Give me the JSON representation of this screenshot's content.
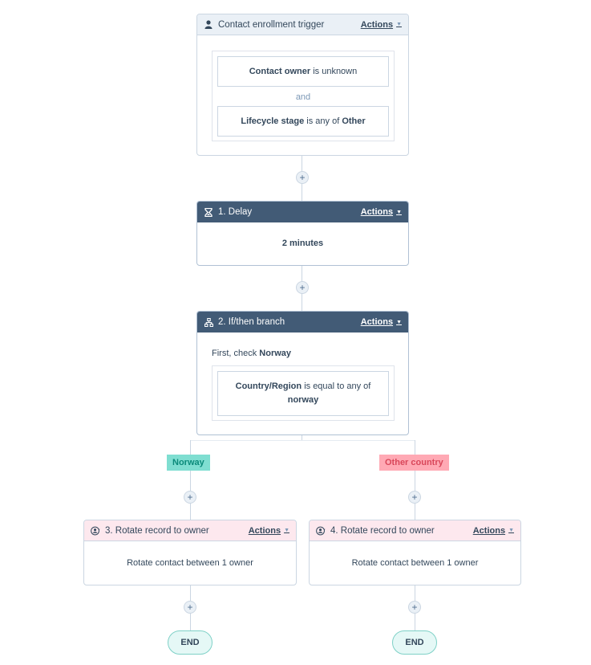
{
  "trigger": {
    "title": "Contact enrollment trigger",
    "icon": "person-icon",
    "actions_label": "Actions",
    "filters": [
      {
        "property": "Contact owner",
        "operator": "is unknown",
        "value": ""
      },
      {
        "property": "Lifecycle stage",
        "operator": "is any of",
        "value": "Other"
      }
    ],
    "joiner": "and"
  },
  "steps": [
    {
      "title": "1. Delay",
      "icon": "hourglass-icon",
      "actions_label": "Actions",
      "body": "2 minutes"
    },
    {
      "title": "2. If/then branch",
      "icon": "branch-icon",
      "actions_label": "Actions",
      "intro_prefix": "First, check",
      "intro_branch": "Norway",
      "filter": {
        "property": "Country/Region",
        "operator": "is equal to any of",
        "value": "norway"
      }
    }
  ],
  "branches": [
    {
      "label": "Norway",
      "color_bg": "#7fded1",
      "color_text": "#0b8a7a",
      "action": {
        "title": "3. Rotate record to owner",
        "icon": "rotate-owner-icon",
        "actions_label": "Actions",
        "body": "Rotate contact between 1 owner"
      },
      "end_label": "END"
    },
    {
      "label": "Other country",
      "color_bg": "#ffa9b4",
      "color_text": "#d9475a",
      "action": {
        "title": "4. Rotate record to owner",
        "icon": "rotate-owner-icon",
        "actions_label": "Actions",
        "body": "Rotate contact between 1 owner"
      },
      "end_label": "END"
    }
  ],
  "add_step_symbol": "+",
  "dropdown_caret": "▼"
}
